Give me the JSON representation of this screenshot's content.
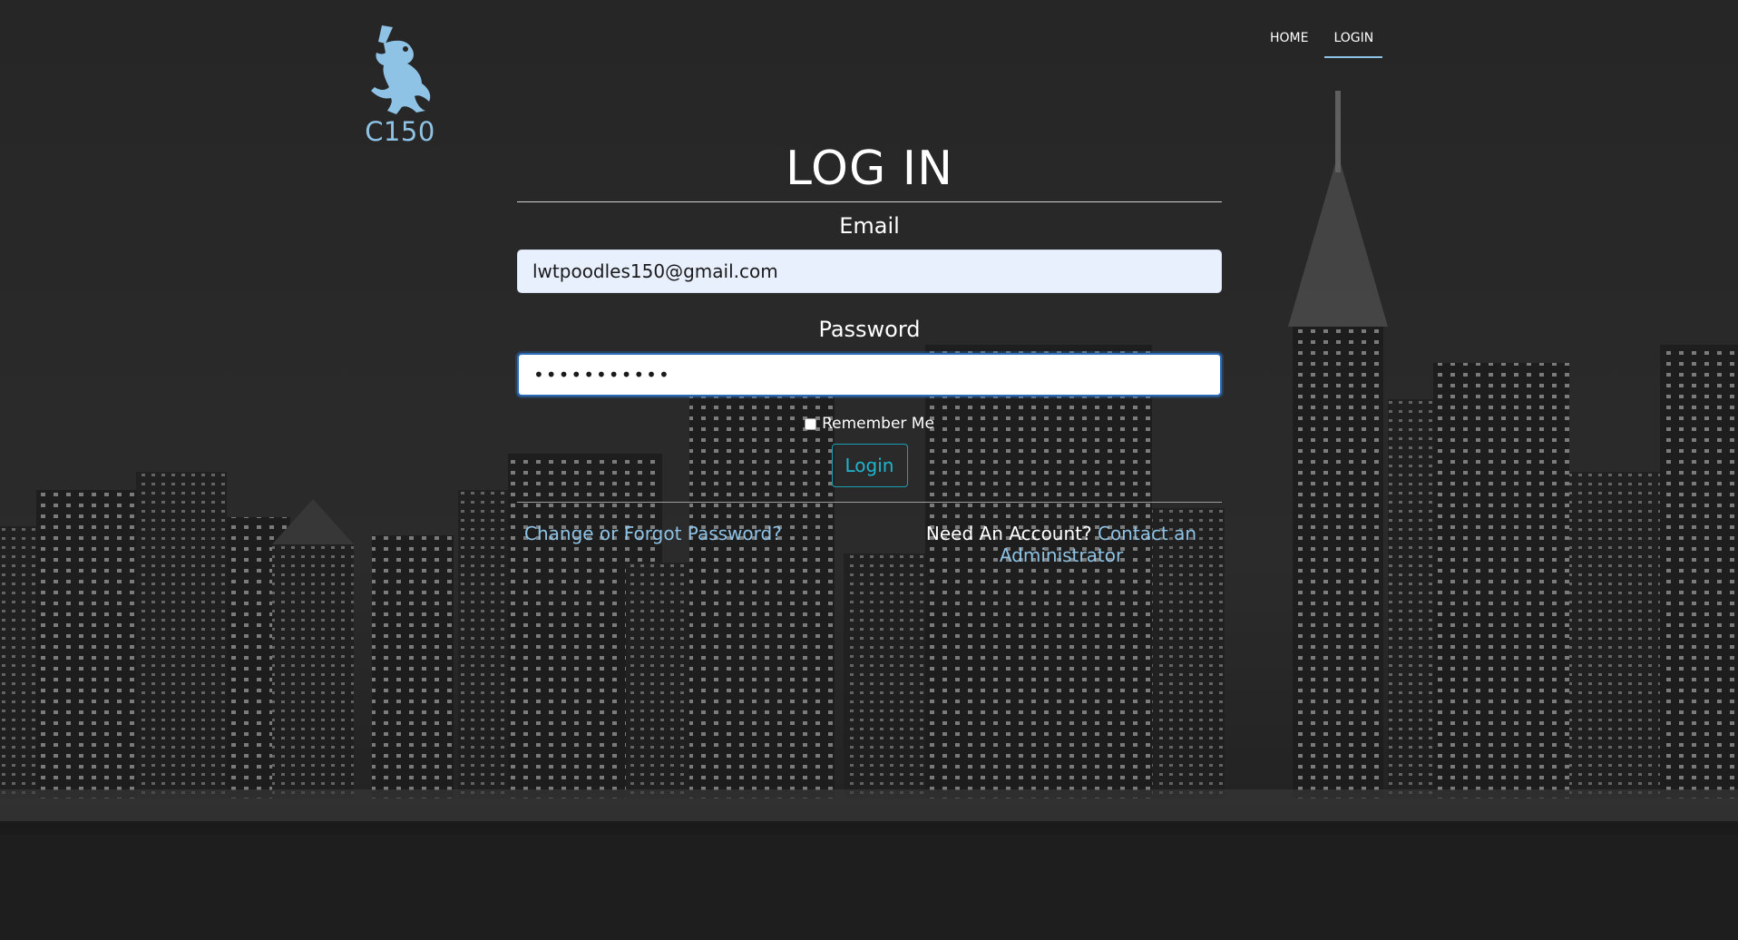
{
  "brand": {
    "logo_text": "C150",
    "accent": "#8ec3e6"
  },
  "nav": {
    "home": "HOME",
    "login": "LOGIN",
    "active": "LOGIN"
  },
  "form": {
    "title": "LOG IN",
    "email_label": "Email",
    "email_value": "lwtpoodles150@gmail.com",
    "password_label": "Password",
    "password_value": "•••••••••••",
    "remember_label": "Remember Me",
    "remember_checked": false,
    "submit_label": "Login"
  },
  "footer_links": {
    "forgot": "Change or Forgot Password?",
    "need_account": "Need An Account?",
    "contact": "Contact an Administrator"
  },
  "icons": {
    "logo": "lion-rampant-icon",
    "checkbox": "checkbox-icon"
  }
}
